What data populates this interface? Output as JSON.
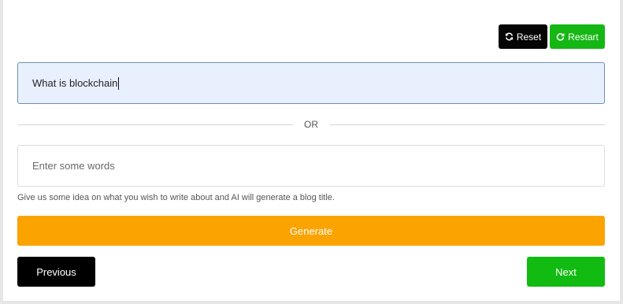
{
  "toolbar": {
    "reset_label": "Reset",
    "reset_icon": "refresh-icon",
    "restart_label": "Restart",
    "restart_icon": "redo-icon"
  },
  "topic": {
    "value": "What is blockchain"
  },
  "divider": {
    "label": "OR"
  },
  "words": {
    "placeholder": "Enter some words",
    "value": ""
  },
  "hint": {
    "text": "Give us some idea on what you wish to write about and AI will generate a blog title."
  },
  "actions": {
    "generate_label": "Generate",
    "previous_label": "Previous",
    "next_label": "Next"
  },
  "colors": {
    "reset": "#050505",
    "restart": "#14b714",
    "generate": "#fba300",
    "previous": "#000000",
    "next": "#11bb11",
    "topic_background": "#e8f0fe"
  }
}
